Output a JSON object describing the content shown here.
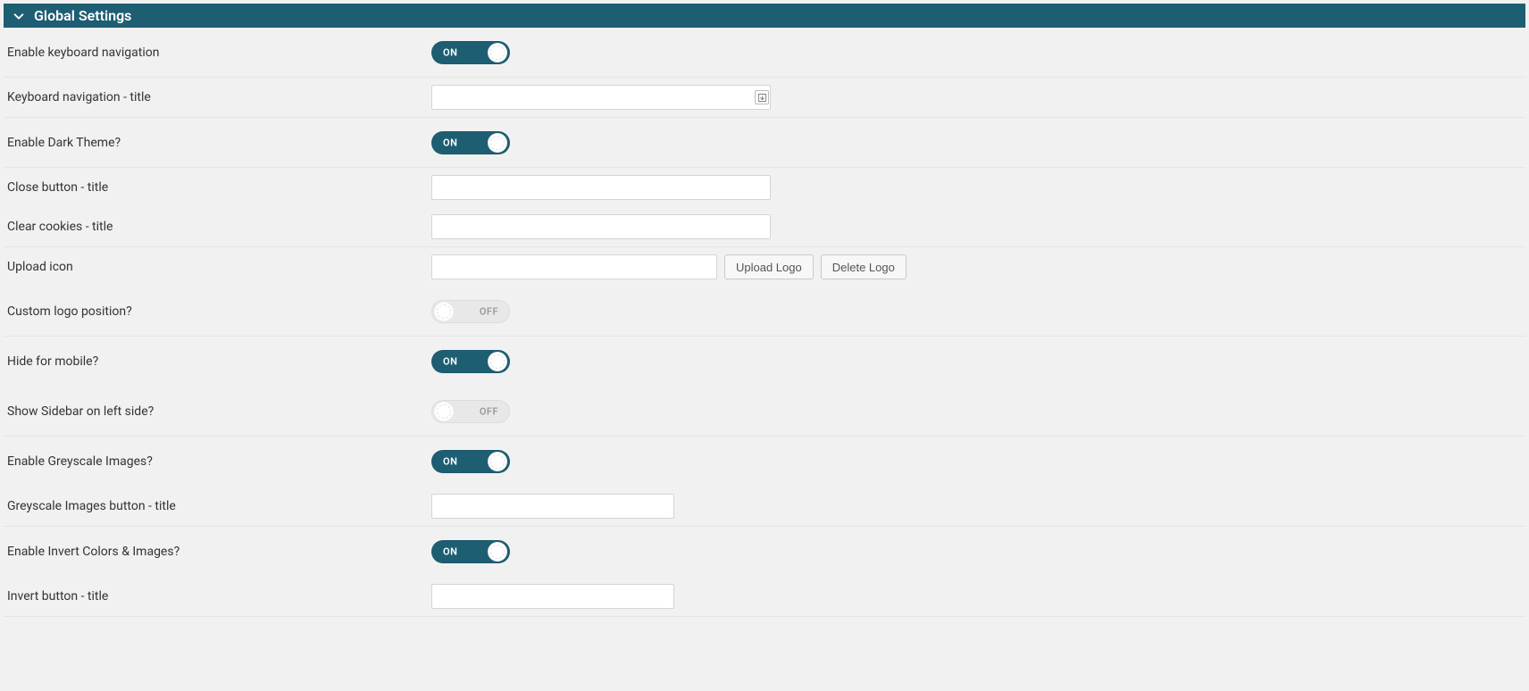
{
  "panel": {
    "title": "Global Settings"
  },
  "toggle_labels": {
    "on": "ON",
    "off": "OFF"
  },
  "rows": {
    "enable_keyboard": {
      "label": "Enable keyboard navigation",
      "state": "on"
    },
    "keyboard_title": {
      "label": "Keyboard navigation - title",
      "value": ""
    },
    "enable_dark": {
      "label": "Enable Dark Theme?",
      "state": "on"
    },
    "close_btn_title": {
      "label": "Close button - title",
      "value": ""
    },
    "clear_cookies": {
      "label": "Clear cookies - title",
      "value": ""
    },
    "upload_icon": {
      "label": "Upload icon",
      "value": "",
      "btn_upload": "Upload Logo",
      "btn_delete": "Delete Logo"
    },
    "custom_logo_pos": {
      "label": "Custom logo position?",
      "state": "off"
    },
    "hide_mobile": {
      "label": "Hide for mobile?",
      "state": "on"
    },
    "sidebar_left": {
      "label": "Show Sidebar on left side?",
      "state": "off"
    },
    "greyscale": {
      "label": "Enable Greyscale Images?",
      "state": "on"
    },
    "greyscale_title": {
      "label": "Greyscale Images button - title",
      "value": ""
    },
    "invert": {
      "label": "Enable Invert Colors & Images?",
      "state": "on"
    },
    "invert_title": {
      "label": "Invert button - title",
      "value": ""
    }
  }
}
